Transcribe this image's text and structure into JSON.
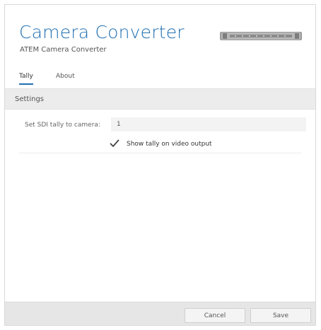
{
  "app": {
    "title": "Camera Converter",
    "subtitle": "ATEM Camera Converter"
  },
  "icons": {
    "device": "device-image-icon",
    "checkmark": "checkmark-icon"
  },
  "tabs": [
    {
      "label": "Tally",
      "active": true
    },
    {
      "label": "About",
      "active": false
    }
  ],
  "settings": {
    "header": "Settings",
    "sdi_tally_label": "Set SDI tally to camera:",
    "sdi_tally_value": "1",
    "show_tally_label": "Show tally on video output",
    "show_tally_checked": true
  },
  "footer": {
    "cancel_label": "Cancel",
    "save_label": "Save"
  },
  "colors": {
    "accent": "#1f6fb2",
    "header_bg": "#ececec",
    "footer_bg": "#e6e6e6"
  }
}
